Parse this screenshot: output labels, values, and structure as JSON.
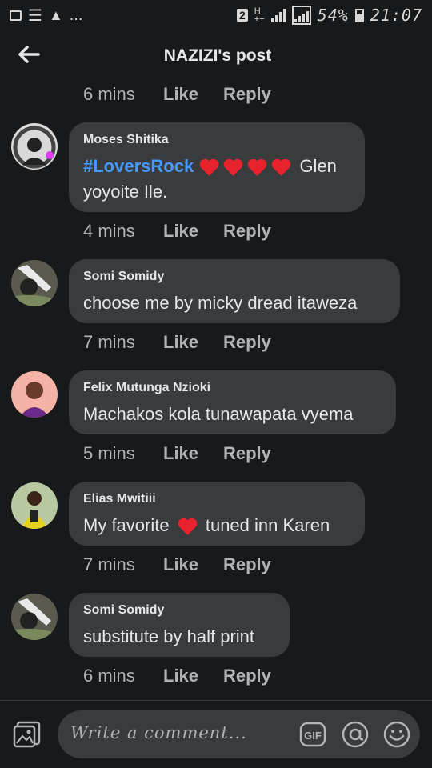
{
  "status_bar": {
    "battery": "54%",
    "time": "21:07",
    "badge": "2",
    "ellipsis": "..."
  },
  "header": {
    "title": "NAZIZI's post",
    "back_icon": "arrow-left-icon"
  },
  "comments": [
    {
      "author": "",
      "text": "",
      "time": "6 mins",
      "like": "Like",
      "reply": "Reply"
    },
    {
      "author": "Moses Shitika",
      "hashtag": "#LoversRock",
      "heart_count": 4,
      "text_line1": "Glen",
      "text_line2": "yoyoite Ile.",
      "time": "4 mins",
      "like": "Like",
      "reply": "Reply"
    },
    {
      "author": "Somi Somidy",
      "text": "choose me by micky dread itaweza",
      "time": "7 mins",
      "like": "Like",
      "reply": "Reply"
    },
    {
      "author": "Felix Mutunga Nzioki",
      "text": "Machakos kola tunawapata vyema",
      "time": "5 mins",
      "like": "Like",
      "reply": "Reply"
    },
    {
      "author": "Elias Mwitiii",
      "text_before": "My favorite",
      "text_after": "tuned inn Karen",
      "time": "7 mins",
      "like": "Like",
      "reply": "Reply"
    },
    {
      "author": "Somi Somidy",
      "text": "substitute by half print",
      "time": "6 mins",
      "like": "Like",
      "reply": "Reply"
    }
  ],
  "composer": {
    "placeholder": "Write a comment...",
    "gif_label": "GIF",
    "icons": [
      "photo-icon",
      "gif-icon",
      "at-icon",
      "emoji-icon"
    ]
  },
  "colors": {
    "background": "#18191a",
    "bubble": "#3a3b3c",
    "hashtag": "#4599ff",
    "heart": "#e8232e",
    "secondary_text": "#b0b3b8"
  }
}
